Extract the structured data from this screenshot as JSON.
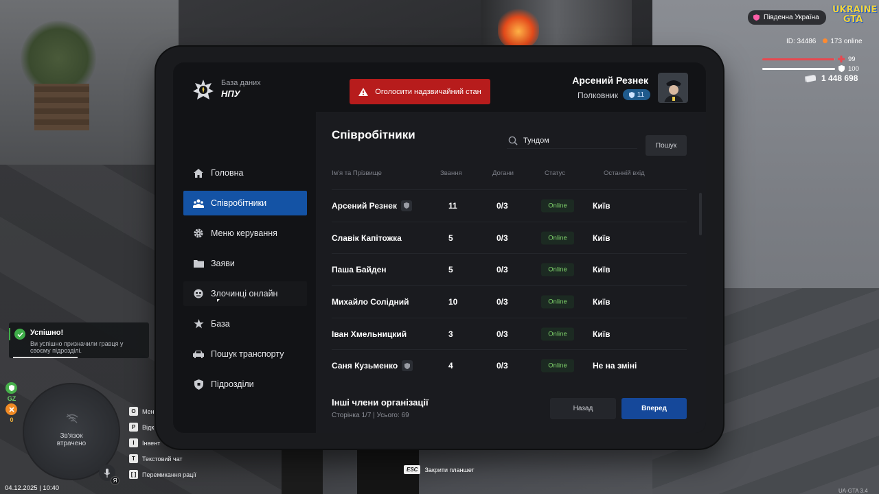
{
  "tablet": {
    "db_caption": "База даних",
    "db_name": "НПУ",
    "emergency_label": "Оголосити надзвичайний стан",
    "user_name": "Арсений Резнек",
    "user_rank": "Полковник",
    "rank_badge": "11"
  },
  "sidebar": {
    "items": [
      {
        "label": "Головна",
        "icon": "home-icon"
      },
      {
        "label": "Співробітники",
        "icon": "people-icon",
        "active": true
      },
      {
        "label": "Меню керування",
        "icon": "gear-icon"
      },
      {
        "label": "Заяви",
        "icon": "folder-icon"
      },
      {
        "label": "Злочинці онлайн",
        "icon": "mask-icon"
      },
      {
        "label": "База",
        "icon": "star-icon"
      },
      {
        "label": "Пошук транспорту",
        "icon": "car-icon"
      },
      {
        "label": "Підрозділи",
        "icon": "shield-icon"
      }
    ]
  },
  "employees": {
    "title": "Співробітники",
    "search_value": "Тундом",
    "search_button": "Пошук",
    "columns": [
      "Ім'я та Прізвище",
      "Звання",
      "Догани",
      "Статус",
      "Останній вхід"
    ],
    "rows": [
      {
        "name": "Арсений Резнек",
        "shield": true,
        "rank": "11",
        "reprimands": "0/3",
        "status": "Online",
        "last": "Київ"
      },
      {
        "name": "Славік Капітожка",
        "shield": false,
        "rank": "5",
        "reprimands": "0/3",
        "status": "Online",
        "last": "Київ"
      },
      {
        "name": "Паша Байден",
        "shield": false,
        "rank": "5",
        "reprimands": "0/3",
        "status": "Online",
        "last": "Київ"
      },
      {
        "name": "Михайло Солідний",
        "shield": false,
        "rank": "10",
        "reprimands": "0/3",
        "status": "Online",
        "last": "Київ"
      },
      {
        "name": "Іван Хмельницкий",
        "shield": false,
        "rank": "3",
        "reprimands": "0/3",
        "status": "Online",
        "last": "Київ"
      },
      {
        "name": "Саня Кузьменко",
        "shield": true,
        "rank": "4",
        "reprimands": "0/3",
        "status": "Online",
        "last": "Не на зміні"
      }
    ],
    "other_title": "Інші члени організації",
    "page_info": "Сторінка 1/7 | Усього: 69",
    "back_label": "Назад",
    "forward_label": "Вперед"
  },
  "hud": {
    "region": "Південна Україна",
    "logo_line1": "UKRAINE",
    "logo_line2": "GTA",
    "player_id": "ID: 34486",
    "online": "173 online",
    "health": "99",
    "armor": "100",
    "health_fraction": 0.99,
    "armor_fraction": 1.0,
    "money": "1 448 698",
    "colors": {
      "health": "#e8484f",
      "armor": "#ffffff",
      "accent": "#1453a5",
      "emergency": "#b71c1c"
    }
  },
  "notification": {
    "title": "Успішно!",
    "text": "Ви успішно призначили гравця у своєму підрозділі."
  },
  "side_icons": {
    "gz_label": "GZ",
    "zero_label": "0"
  },
  "radar": {
    "line1": "Зв'язок",
    "line2": "втрачено",
    "mic_badge": "Я"
  },
  "hotkeys": [
    {
      "key": "O",
      "label": "Мен"
    },
    {
      "key": "P",
      "label": "Відк"
    },
    {
      "key": "I",
      "label": "Інвент"
    },
    {
      "key": "T",
      "label": "Текстовий чат"
    },
    {
      "key": "[ ]",
      "label": "Перемикання рації"
    }
  ],
  "esc_hint": {
    "key": "ESC",
    "label": "Закрити планшет"
  },
  "datetime": "04.12.2025 | 10:40",
  "version": "UA-GTA 3.4"
}
